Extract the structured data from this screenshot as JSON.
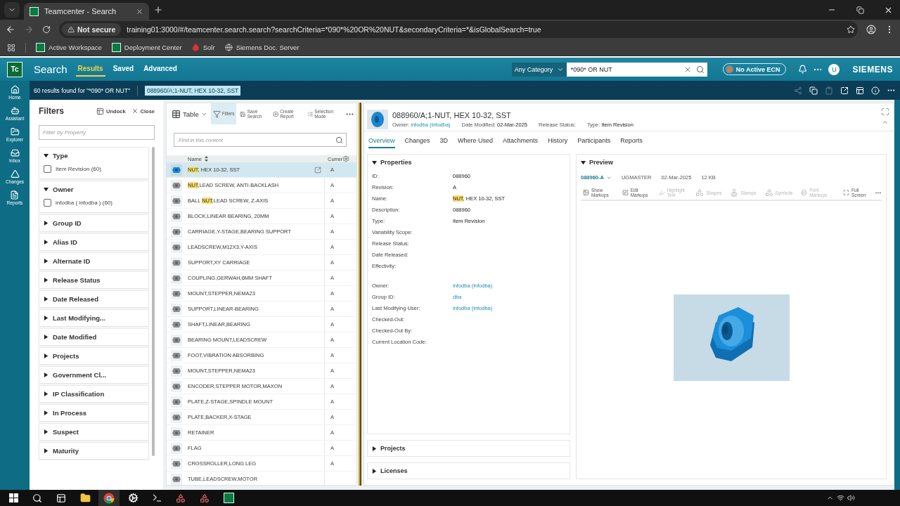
{
  "browser": {
    "tab_title": "Teamcenter - Search",
    "security": "Not secure",
    "url": "training01:3000/#/teamcenter.search.search?searchCriteria=*090*%20OR%20NUT&secondaryCriteria=*&isGlobalSearch=true",
    "bookmarks": [
      "Active Workspace",
      "Deployment Center",
      "Solr",
      "Siemens Doc. Server"
    ]
  },
  "header": {
    "logo": "Tc",
    "title": "Search",
    "tabs": [
      {
        "label": "Results",
        "selected": true
      },
      {
        "label": "Saved",
        "selected": false
      },
      {
        "label": "Advanced",
        "selected": false
      }
    ],
    "category": "Any Category",
    "search_value": "*090* OR NUT",
    "ecn": "No Active ECN",
    "avatar": "U",
    "brand": "SIEMENS"
  },
  "subheader": {
    "results": "60 results found for \"*090* OR NUT\"",
    "selection": "088960/A;1-NUT, HEX 10-32, SST"
  },
  "nav": [
    "Home",
    "Assistant",
    "Explorer",
    "Inbox",
    "Changes",
    "Reports"
  ],
  "filters": {
    "title": "Filters",
    "undock": "Undock",
    "close": "Close",
    "placeholder": "Filter by Property",
    "groups": [
      {
        "label": "Type",
        "expanded": true,
        "options": [
          {
            "label": "Item Revision (60)",
            "checked": false
          }
        ]
      },
      {
        "label": "Owner",
        "expanded": true,
        "options": [
          {
            "label": "infodba ( infodba ) (60)",
            "checked": false
          }
        ]
      },
      {
        "label": "Group ID",
        "expanded": false
      },
      {
        "label": "Alias ID",
        "expanded": false
      },
      {
        "label": "Alternate ID",
        "expanded": false
      },
      {
        "label": "Release Status",
        "expanded": false
      },
      {
        "label": "Date Released",
        "expanded": false
      },
      {
        "label": "Last Modifying...",
        "expanded": false
      },
      {
        "label": "Date Modified",
        "expanded": false
      },
      {
        "label": "Projects",
        "expanded": false
      },
      {
        "label": "Government Cl...",
        "expanded": false
      },
      {
        "label": "IP Classification",
        "expanded": false
      },
      {
        "label": "In Process",
        "expanded": false
      },
      {
        "label": "Suspect",
        "expanded": false
      },
      {
        "label": "Maturity",
        "expanded": false
      }
    ]
  },
  "table": {
    "view": "Table",
    "tools": [
      {
        "label": "Filters",
        "selected": true
      },
      {
        "label": "Save Search",
        "selected": false
      },
      {
        "label": "Create Report",
        "selected": false
      },
      {
        "label": "Selection Mode",
        "selected": false
      }
    ],
    "find_placeholder": "Find in this content",
    "columns": [
      "Name",
      "Currer"
    ],
    "rows": [
      {
        "name": "**NUT**, HEX 10-32, SST",
        "revision": "A",
        "selected": true
      },
      {
        "name": "**NUT**,LEAD SCREW, ANTI-BACKLASH",
        "revision": "A",
        "selected": false
      },
      {
        "name": "BALL **NUT**,LEAD SCREW, Z-AXIS",
        "revision": "A",
        "selected": false
      },
      {
        "name": "BLOCK,LINEAR BEARING, 20MM",
        "revision": "A",
        "selected": false
      },
      {
        "name": "CARRIAGE,Y-STAGE,BEARING SUPPORT",
        "revision": "A",
        "selected": false
      },
      {
        "name": "LEADSCREW,M12X3,Y-AXIS",
        "revision": "A",
        "selected": false
      },
      {
        "name": "SUPPORT,XY CARRIAGE",
        "revision": "A",
        "selected": false
      },
      {
        "name": "COUPLING,GERWAH,6MM SHAFT",
        "revision": "A",
        "selected": false
      },
      {
        "name": "MOUNT,STEPPER,NEMA23",
        "revision": "A",
        "selected": false
      },
      {
        "name": "SUPPORT,LINEAR-BEARING",
        "revision": "A",
        "selected": false
      },
      {
        "name": "SHAFT,LINEAR,BEARING",
        "revision": "A",
        "selected": false
      },
      {
        "name": "BEARING MOUNT,LEADSCREW",
        "revision": "A",
        "selected": false
      },
      {
        "name": "FOOT,VIBRATION ABSORBING",
        "revision": "A",
        "selected": false
      },
      {
        "name": "MOUNT,STEPPER,NEMA23",
        "revision": "A",
        "selected": false
      },
      {
        "name": "ENCODER,STEPPER MOTOR,MAXON",
        "revision": "A",
        "selected": false
      },
      {
        "name": "PLATE,Z-STAGE,SPINDLE MOUNT",
        "revision": "A",
        "selected": false
      },
      {
        "name": "PLATE,BACKER,X-STAGE",
        "revision": "A",
        "selected": false
      },
      {
        "name": "RETAINER",
        "revision": "A",
        "selected": false
      },
      {
        "name": "FLAG",
        "revision": "A",
        "selected": false
      },
      {
        "name": "CROSSROLLER,LONG LEG",
        "revision": "A",
        "selected": false
      },
      {
        "name": "TUBE,LEADSCREW,MOTOR",
        "selected": false
      }
    ]
  },
  "detail": {
    "title": "088960/A;1-NUT, HEX 10-32, SST",
    "meta": [
      {
        "label": "Owner:",
        "value": "infodba (infodba)",
        "link": true
      },
      {
        "label": "Date Modified:",
        "value": "02-Mar-2025",
        "link": false
      },
      {
        "label": "Release Status:"
      },
      {
        "label": "Type:",
        "value": "Item Revision",
        "link": false
      }
    ],
    "tabs": [
      {
        "label": "Overview",
        "selected": true
      },
      {
        "label": "Changes",
        "selected": false
      },
      {
        "label": "3D",
        "selected": false
      },
      {
        "label": "Where Used",
        "selected": false
      },
      {
        "label": "Attachments",
        "selected": false
      },
      {
        "label": "History",
        "selected": false
      },
      {
        "label": "Participants",
        "selected": false
      },
      {
        "label": "Reports",
        "selected": false
      }
    ],
    "properties": {
      "title": "Properties",
      "expanded": true,
      "groups": [
        {
          "rows": [
            {
              "label": "ID:",
              "value": "088960",
              "link": false
            },
            {
              "label": "Revision:",
              "value": "A",
              "link": false
            },
            {
              "label": "Name:",
              "value": "**NUT**, HEX 10-32, SST",
              "link": false
            },
            {
              "label": "Description:",
              "value": "088960",
              "link": false
            },
            {
              "label": "Type:",
              "value": "Item Revision",
              "link": false
            },
            {
              "label": "Variability Scope:"
            },
            {
              "label": "Release Status:"
            },
            {
              "label": "Date Released:"
            },
            {
              "label": "Effectivity:"
            }
          ]
        },
        {
          "rows": [
            {
              "label": "Owner:",
              "value": "infodba (infodba)",
              "link": true
            },
            {
              "label": "Group ID:",
              "value": "dba",
              "link": true
            },
            {
              "label": "Last Modifying User:",
              "value": "infodba (infodba)",
              "link": true
            },
            {
              "label": "Checked-Out:"
            },
            {
              "label": "Checked-Out By:"
            },
            {
              "label": "Current Location Code:"
            }
          ]
        }
      ]
    },
    "sections": [
      {
        "label": "Projects",
        "expanded": false
      },
      {
        "label": "Licenses",
        "expanded": false
      }
    ],
    "preview": {
      "title": "Preview",
      "expanded": true,
      "version": "088960-A",
      "info": [
        "UGMASTER",
        "02-Mar-2025",
        "12 KB"
      ],
      "tools": [
        {
          "label": "Show Markups",
          "disabled": false
        },
        {
          "label": "Edit Markups",
          "disabled": false
        },
        {
          "label": "Highlight Text",
          "disabled": true
        },
        {
          "label": "Shapes",
          "disabled": true
        },
        {
          "label": "Stamps",
          "disabled": true
        },
        {
          "label": "Symbols",
          "disabled": true
        },
        {
          "label": "Print Markups",
          "disabled": true
        },
        {
          "label": "Full Screen",
          "disabled": false
        }
      ]
    }
  }
}
